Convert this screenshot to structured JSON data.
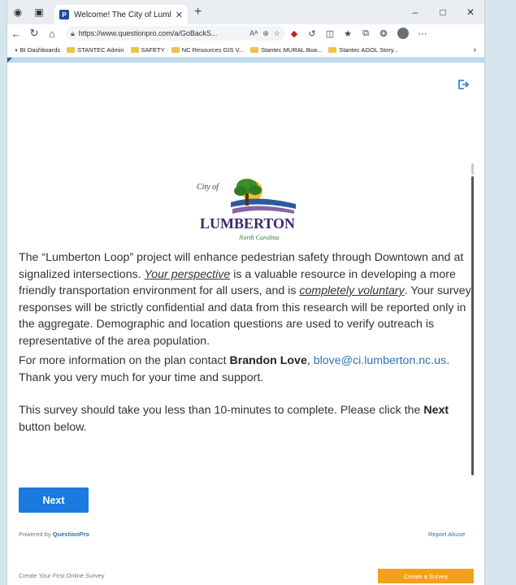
{
  "browser": {
    "tab_title": "Welcome! The City of Lumberto",
    "favicon_letter": "P",
    "url": "https://www.questionpro.com/a/GoBackS...",
    "address_icons": [
      "Aᴬ",
      "⊕",
      "☆"
    ],
    "bookmarks": [
      {
        "label": "BI Dashboards",
        "icon": "bi-icon"
      },
      {
        "label": "STANTEC Admin",
        "icon": "folder-icon"
      },
      {
        "label": "SAFETY",
        "icon": "folder-icon"
      },
      {
        "label": "NC Resources GIS V...",
        "icon": "folder-icon"
      },
      {
        "label": "Stantec MURAL Boa...",
        "icon": "folder-icon"
      },
      {
        "label": "Stantec AGOL Story...",
        "icon": "folder-icon"
      }
    ]
  },
  "logo": {
    "city_of": "City of",
    "name": "LUMBERTON",
    "state": "North Carolina"
  },
  "survey": {
    "p1": {
      "a": "The “Lumberton Loop” project will enhance pedestrian safety through Downtown and at signalized intersections. ",
      "em1": "Your perspective",
      "b": " is a valuable resource in developing a more friendly transportation environment for all users, and is ",
      "em2": "completely voluntary",
      "c": ". Your survey responses will be strictly confidential and data from this research will be reported only in the aggregate. Demographic and location questions are used to verify outreach is representative of the area population."
    },
    "p2": {
      "a": "For more information on the plan contact ",
      "name": "Brandon Love",
      "b": ", ",
      "email": "blove@ci.lumberton.nc.us",
      "c": ". Thank you very much for your time and support."
    },
    "p3": {
      "a": "This survey should take you less than 10-minutes to complete. Please click the ",
      "strong": "Next",
      "b": " button below."
    },
    "next_label": "Next"
  },
  "footer": {
    "powered_prefix": "Powered by ",
    "powered_brand": "QuestionPro",
    "report_abuse": "Report Abuse",
    "create_first": "Create Your First Online Survey",
    "create_button": "Create a Survey"
  },
  "colors": {
    "accent": "#1a7ae0",
    "link": "#2f73b8",
    "create_button": "#f5a01a"
  }
}
